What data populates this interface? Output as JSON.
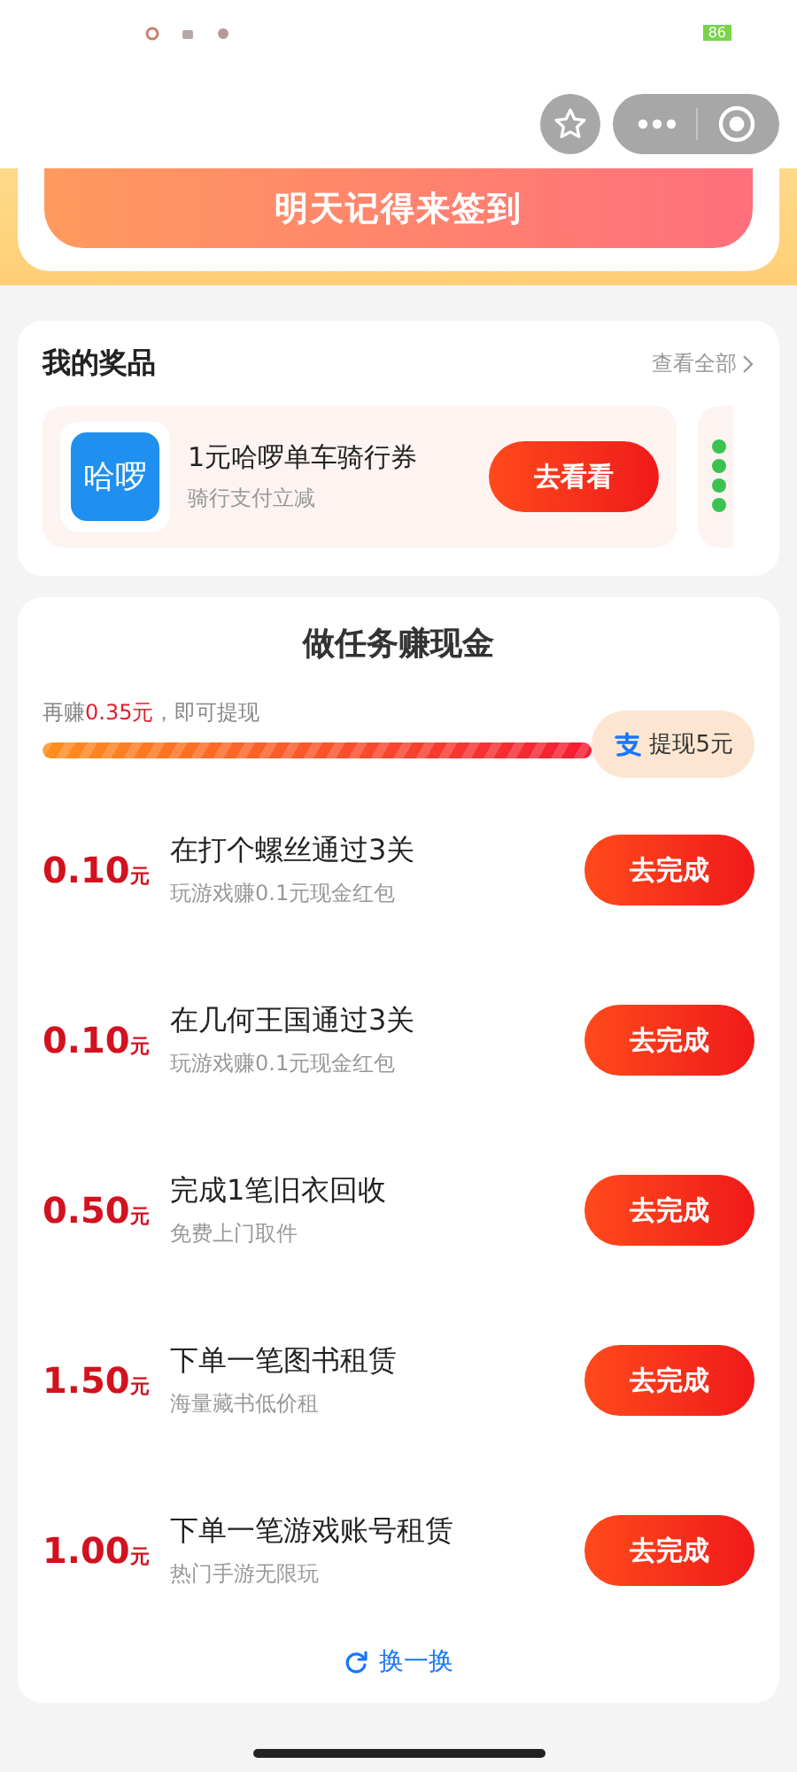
{
  "status_bar": {
    "battery": "86"
  },
  "checkin": {
    "button": "明天记得来签到"
  },
  "prizes": {
    "title": "我的奖品",
    "view_all": "查看全部",
    "items": [
      {
        "logo": "哈啰",
        "title": "1元哈啰单车骑行券",
        "subtitle": "骑行支付立减",
        "button": "去看看"
      }
    ]
  },
  "tasks": {
    "title": "做任务赚现金",
    "progress_text": "再赚**0.35元**，即可提现",
    "level": 0.77,
    "withdraw": "提现5元",
    "items": [
      {
        "amount": "0.10",
        "unit": "元",
        "title": "在打个螺丝通过3关",
        "subtitle": "玩游戏赚0.1元现金红包",
        "button": "去完成"
      },
      {
        "amount": "0.10",
        "unit": "元",
        "title": "在几何王国通过3关",
        "subtitle": "玩游戏赚0.1元现金红包",
        "button": "去完成"
      },
      {
        "amount": "0.50",
        "unit": "元",
        "title": "完成1笔旧衣回收",
        "subtitle": "免费上门取件",
        "button": "去完成"
      },
      {
        "amount": "1.50",
        "unit": "元",
        "title": "下单一笔图书租赁",
        "subtitle": "海量藏书低价租",
        "button": "去完成"
      },
      {
        "amount": "1.00",
        "unit": "元",
        "title": "下单一笔游戏账号租赁",
        "subtitle": "热门手游无限玩",
        "button": "去完成"
      }
    ],
    "refresh": "换一换"
  }
}
